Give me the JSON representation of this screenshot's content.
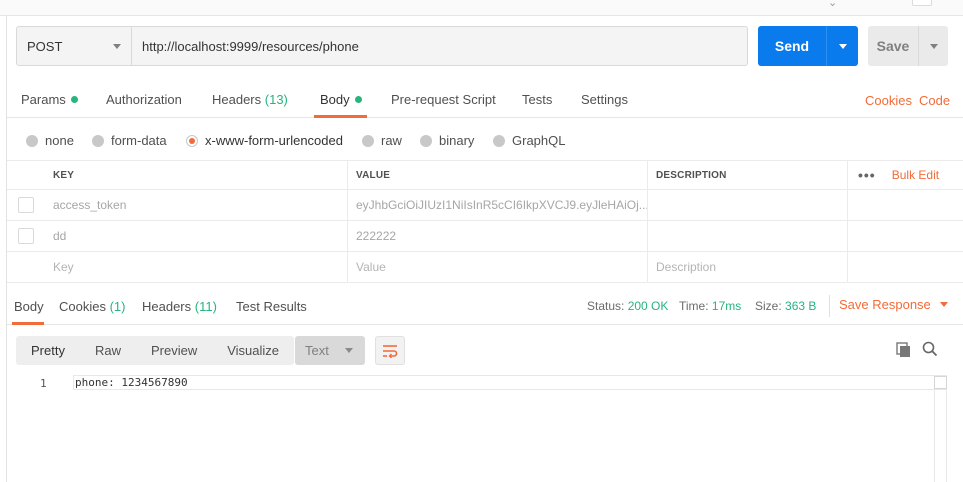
{
  "request": {
    "method": "POST",
    "url": "http://localhost:9999/resources/phone",
    "send_label": "Send",
    "save_label": "Save"
  },
  "request_tabs": [
    {
      "label": "Params",
      "dot": true
    },
    {
      "label": "Authorization"
    },
    {
      "label": "Headers",
      "count": "(13)"
    },
    {
      "label": "Body",
      "dot": true,
      "active": true
    },
    {
      "label": "Pre-request Script"
    },
    {
      "label": "Tests"
    },
    {
      "label": "Settings"
    }
  ],
  "request_links": {
    "cookies": "Cookies",
    "code": "Code"
  },
  "body_types": [
    {
      "label": "none"
    },
    {
      "label": "form-data"
    },
    {
      "label": "x-www-form-urlencoded",
      "selected": true
    },
    {
      "label": "raw"
    },
    {
      "label": "binary"
    },
    {
      "label": "GraphQL"
    }
  ],
  "params_table": {
    "headers": {
      "key": "KEY",
      "value": "VALUE",
      "description": "DESCRIPTION",
      "more": "•••",
      "bulk_edit": "Bulk Edit"
    },
    "rows": [
      {
        "key": "access_token",
        "value": "eyJhbGciOiJIUzI1NiIsInR5cCI6IkpXVCJ9.eyJleHAiOj...",
        "description": ""
      },
      {
        "key": "dd",
        "value": "222222",
        "description": ""
      }
    ],
    "placeholders": {
      "key": "Key",
      "value": "Value",
      "description": "Description"
    }
  },
  "response_tabs": [
    {
      "label": "Body",
      "active": true
    },
    {
      "label": "Cookies",
      "count": "(1)"
    },
    {
      "label": "Headers",
      "count": "(11)"
    },
    {
      "label": "Test Results"
    }
  ],
  "response_status": {
    "status_label": "Status:",
    "status_value": "200 OK",
    "time_label": "Time:",
    "time_value": "17ms",
    "size_label": "Size:",
    "size_value": "363 B",
    "save_response": "Save Response"
  },
  "view_modes": [
    {
      "label": "Pretty",
      "active": true
    },
    {
      "label": "Raw"
    },
    {
      "label": "Preview"
    },
    {
      "label": "Visualize"
    }
  ],
  "format_select": "Text",
  "editor": {
    "lines": [
      {
        "number": "1",
        "text": "phone: 1234567890"
      }
    ]
  },
  "colors": {
    "accent": "#f26b3a",
    "primary": "#097bed",
    "success": "#26b47f"
  },
  "icons": [
    "chevron-down-icon",
    "wrap-lines-icon",
    "copy-icon",
    "search-icon"
  ]
}
